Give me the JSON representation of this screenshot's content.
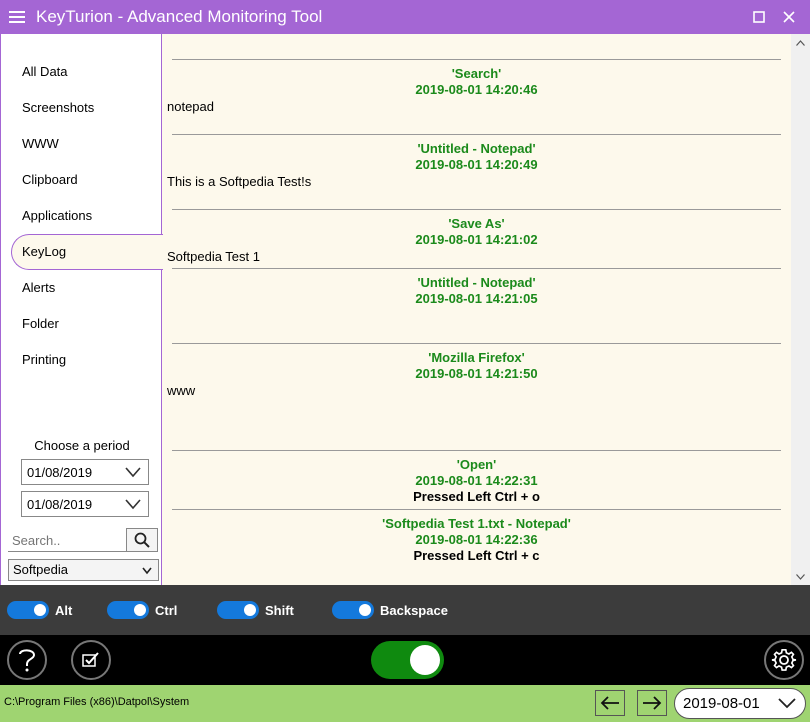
{
  "window": {
    "title": "KeyTurion - Advanced Monitoring Tool"
  },
  "sidebar": {
    "items": [
      {
        "label": "All Data"
      },
      {
        "label": "Screenshots"
      },
      {
        "label": "WWW"
      },
      {
        "label": "Clipboard"
      },
      {
        "label": "Applications"
      },
      {
        "label": "KeyLog",
        "active": true
      },
      {
        "label": "Alerts"
      },
      {
        "label": "Folder"
      },
      {
        "label": "Printing"
      }
    ],
    "period_label": "Choose a period",
    "date_from": "01/08/2019",
    "date_to": "01/08/2019",
    "search_placeholder": "Search..",
    "user_selected": "Softpedia"
  },
  "log": [
    {
      "app": "'Search'",
      "time": "2019-08-01 14:20:46",
      "text": "notepad"
    },
    {
      "app": "'Untitled - Notepad'",
      "time": "2019-08-01 14:20:49",
      "text": "This is a Softpedia Test!s"
    },
    {
      "app": "'Save As'",
      "time": "2019-08-01 14:21:02",
      "text": "Softpedia Test 1"
    },
    {
      "app": "'Untitled - Notepad'",
      "time": "2019-08-01 14:21:05",
      "text": ""
    },
    {
      "app": "'Mozilla Firefox'",
      "time": "2019-08-01 14:21:50",
      "text": "www"
    },
    {
      "app": "'Open'",
      "time": "2019-08-01 14:22:31",
      "keys": "Pressed Left Ctrl + o"
    },
    {
      "app": "'Softpedia Test 1.txt - Notepad'",
      "time": "2019-08-01 14:22:36",
      "keys": "Pressed Left Ctrl + c"
    }
  ],
  "toggles": [
    {
      "label": "Alt",
      "on": true
    },
    {
      "label": "Ctrl",
      "on": true
    },
    {
      "label": "Shift",
      "on": true
    },
    {
      "label": "Backspace",
      "on": true
    }
  ],
  "status": {
    "path": "C:\\Program Files (x86)\\Datpol\\System",
    "date": "2019-08-01"
  },
  "colors": {
    "title_bar": "#a466d4",
    "log_heading": "#1b8a1b",
    "toggle_on": "#1479dc",
    "monitor_toggle": "#0f8a0f",
    "status_bar": "#9fd471"
  },
  "icons": {
    "menu": "hamburger-icon",
    "maximize": "maximize-icon",
    "close": "close-icon",
    "search": "search-icon",
    "help": "help-icon",
    "tasks": "checklist-icon",
    "settings": "gear-icon",
    "back": "arrow-left-icon",
    "forward": "arrow-right-icon"
  }
}
